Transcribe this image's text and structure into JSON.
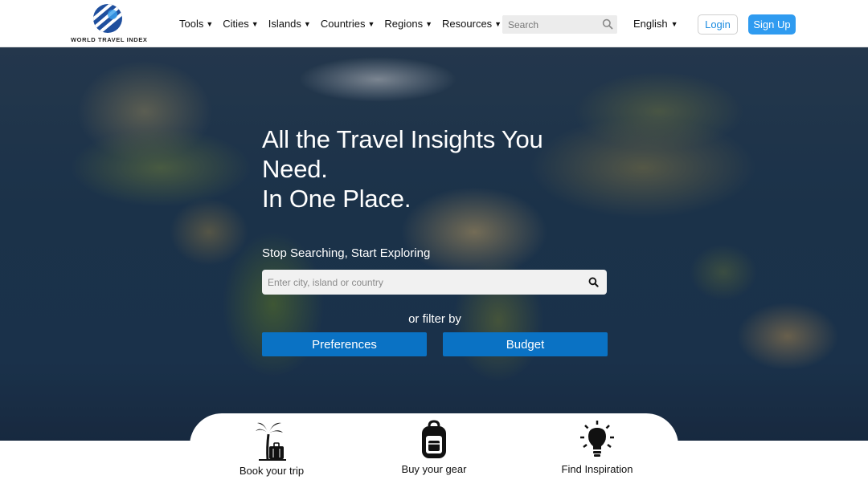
{
  "header": {
    "logo_text": "WORLD TRAVEL INDEX",
    "nav": [
      {
        "label": "Tools"
      },
      {
        "label": "Cities"
      },
      {
        "label": "Islands"
      },
      {
        "label": "Countries"
      },
      {
        "label": "Regions"
      },
      {
        "label": "Resources"
      }
    ],
    "search_placeholder": "Search",
    "language": "English",
    "login_label": "Login",
    "signup_label": "Sign Up"
  },
  "hero": {
    "headline_line1": "All the Travel Insights You Need.",
    "headline_line2": "In One Place.",
    "subheading": "Stop Searching, Start Exploring",
    "search_placeholder": "Enter city, island or country",
    "filter_label": "or filter by",
    "preferences_label": "Preferences",
    "budget_label": "Budget"
  },
  "features": [
    {
      "label": "Book your trip",
      "icon": "palm-suitcase-icon"
    },
    {
      "label": "Buy your gear",
      "icon": "backpack-icon"
    },
    {
      "label": "Find Inspiration",
      "icon": "lightbulb-icon"
    }
  ],
  "colors": {
    "brand_blue": "#2f9bf0",
    "button_blue": "#0a72c4",
    "login_text": "#1a8be0"
  }
}
